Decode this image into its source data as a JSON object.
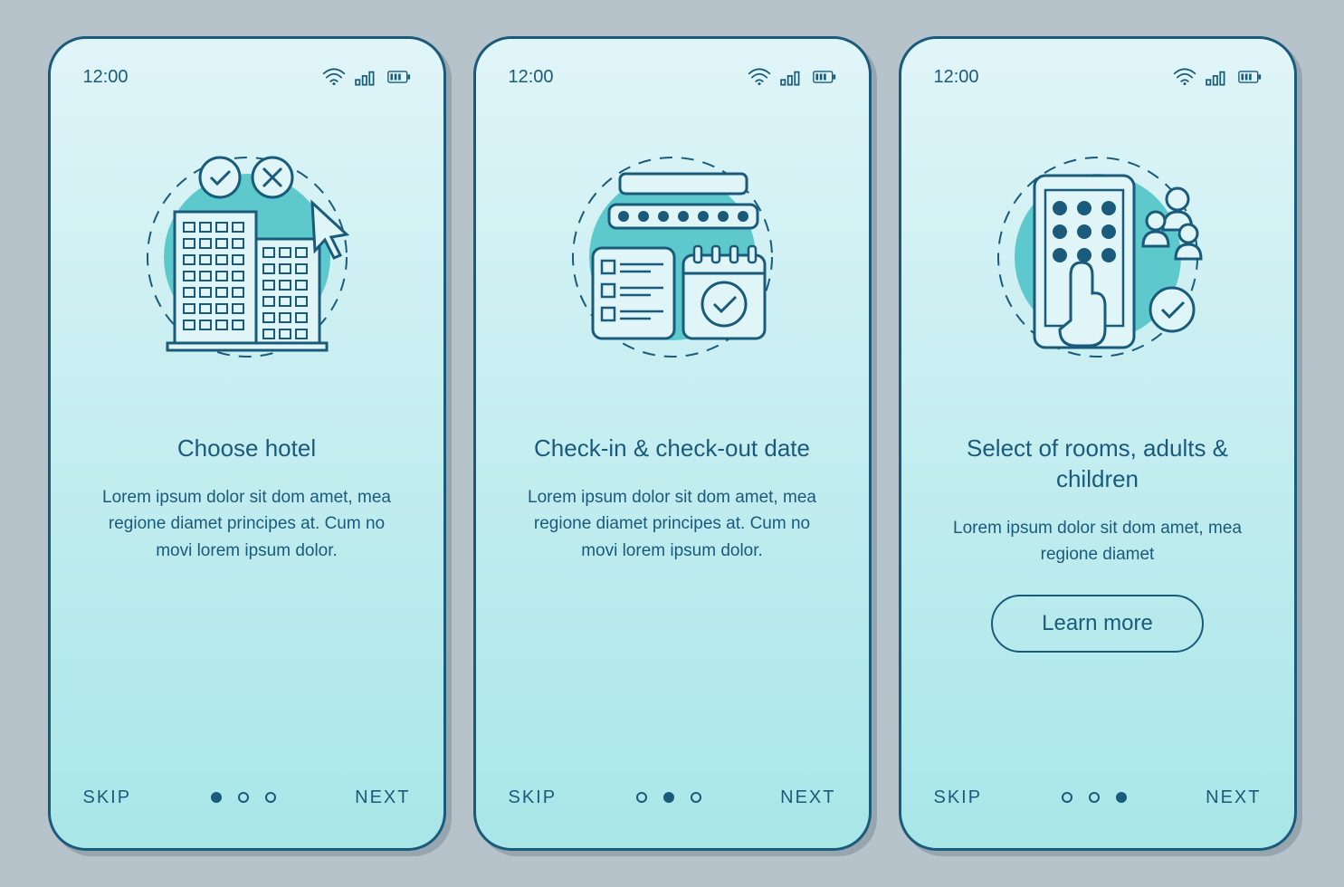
{
  "status_time": "12:00",
  "skip_label": "SKIP",
  "next_label": "NEXT",
  "learn_more_label": "Learn more",
  "screens": [
    {
      "title": "Choose hotel",
      "body": "Lorem ipsum dolor sit dom amet, mea regione diamet principes at. Cum no movi lorem ipsum dolor.",
      "active_dot": 0,
      "has_button": false,
      "illustration": "hotel"
    },
    {
      "title": "Check-in & check-out date",
      "body": "Lorem ipsum dolor sit dom amet, mea regione diamet principes at. Cum no movi lorem ipsum dolor.",
      "active_dot": 1,
      "has_button": false,
      "illustration": "calendar"
    },
    {
      "title": "Select of rooms, adults & children",
      "body": "Lorem ipsum dolor sit dom amet, mea regione diamet",
      "active_dot": 2,
      "has_button": true,
      "illustration": "people"
    }
  ]
}
